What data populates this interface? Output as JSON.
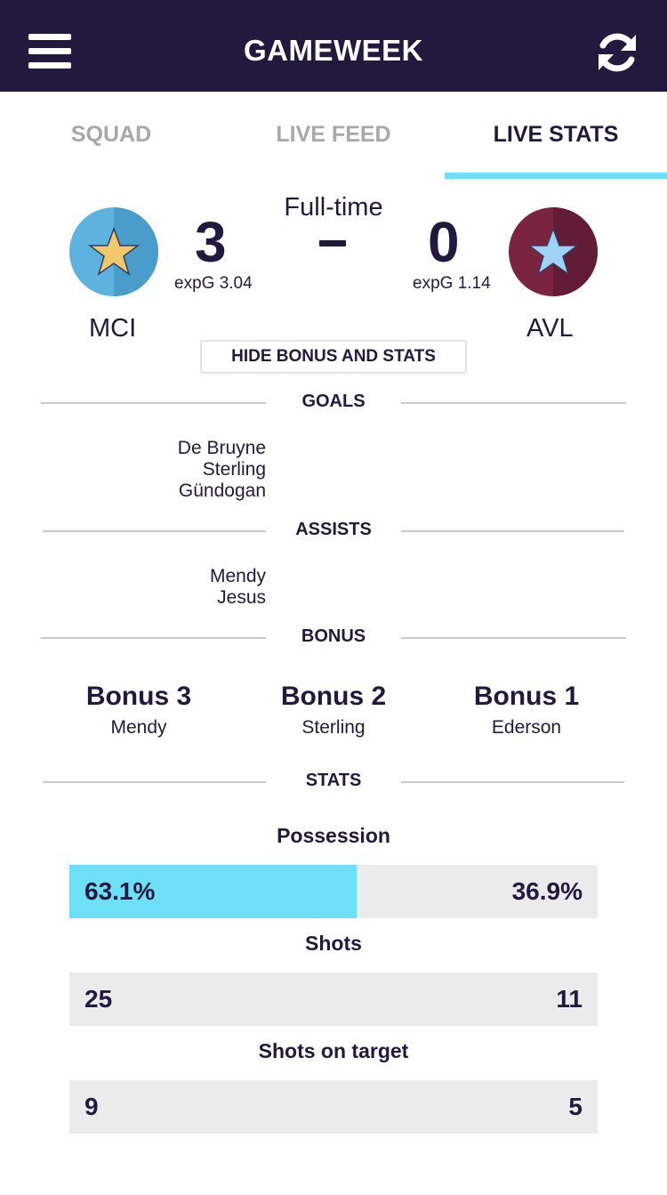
{
  "header": {
    "title": "GAMEWEEK",
    "menu_icon": "hamburger-menu-icon",
    "refresh_icon": "refresh-icon"
  },
  "tabs": [
    {
      "label": "SQUAD",
      "active": false
    },
    {
      "label": "LIVE FEED",
      "active": false
    },
    {
      "label": "LIVE STATS",
      "active": true
    }
  ],
  "match": {
    "status": "Full-time",
    "home": {
      "code": "MCI",
      "score": "3",
      "expg": "expG 3.04",
      "crest_color": "#5eb2e0",
      "star_color": "#f0c96b"
    },
    "away": {
      "code": "AVL",
      "score": "0",
      "expg": "expG 1.14",
      "crest_color": "#7a2442",
      "star_color": "#9fd3f5"
    }
  },
  "toggle_label": "HIDE BONUS AND STATS",
  "sections": {
    "goals": {
      "label": "GOALS",
      "home_players": [
        "De Bruyne",
        "Sterling",
        "Gündogan"
      ]
    },
    "assists": {
      "label": "ASSISTS",
      "home_players": [
        "Mendy",
        "Jesus"
      ]
    },
    "bonus": {
      "label": "BONUS",
      "items": [
        {
          "title": "Bonus 3",
          "player": "Mendy"
        },
        {
          "title": "Bonus 2",
          "player": "Sterling"
        },
        {
          "title": "Bonus 1",
          "player": "Ederson"
        }
      ]
    },
    "stats": {
      "label": "STATS",
      "items": [
        {
          "title": "Possession",
          "home": "63.1%",
          "away": "36.9%",
          "home_fraction": 0.544
        },
        {
          "title": "Shots",
          "home": "25",
          "away": "11",
          "home_fraction": 0
        },
        {
          "title": "Shots on target",
          "home": "9",
          "away": "5",
          "home_fraction": 0
        }
      ]
    }
  },
  "colors": {
    "navy": "#23193f",
    "accent": "#6de0f7",
    "bar_bg": "#ebebeb"
  }
}
